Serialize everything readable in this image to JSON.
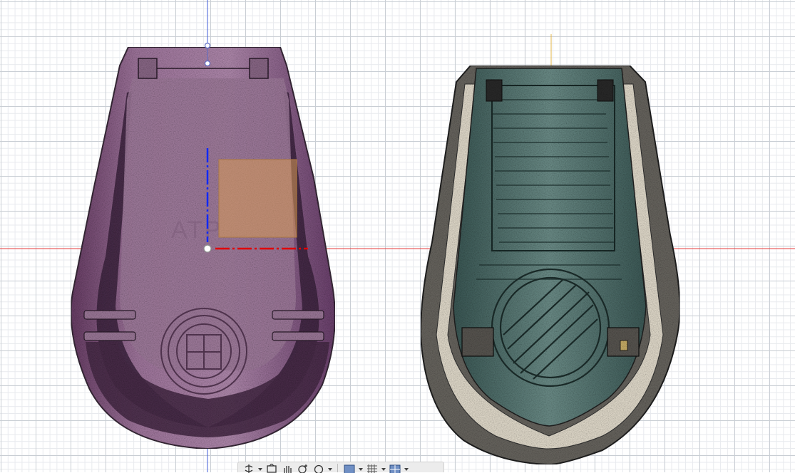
{
  "viewport": {
    "grid": true,
    "colors": {
      "grid_major": "#c9ced4",
      "grid_minor": "#e8eaee",
      "x_axis": "#e63b3b",
      "y_axis_left": "#3f5bd8",
      "y_axis_right": "#e3b64a"
    },
    "bodies": [
      {
        "name": "left-body",
        "view": "underside",
        "color": "#9a6a96"
      },
      {
        "name": "right-body",
        "view": "inside",
        "color": "#5d7f7b",
        "shell_color": "#6b6862"
      }
    ]
  },
  "sketch": {
    "watermark_text": "ATP",
    "colors": {
      "profile_fill": "#d89a55",
      "profile_edge": "#b07a3e",
      "axis_blue": "#1029ff",
      "axis_red": "#e00000"
    }
  },
  "nav_toolbar": {
    "buttons": [
      {
        "name": "orbit",
        "icon": "orbit-icon",
        "has_menu": true
      },
      {
        "name": "look-at",
        "icon": "look-at-icon",
        "has_menu": false
      },
      {
        "name": "pan",
        "icon": "pan-hand-icon",
        "has_menu": false
      },
      {
        "name": "zoom",
        "icon": "zoom-icon",
        "has_menu": false
      },
      {
        "name": "zoom-window",
        "icon": "zoom-window-icon",
        "has_menu": true
      },
      {
        "name": "display-settings",
        "icon": "display-settings-icon",
        "has_menu": true
      },
      {
        "name": "grid-snaps",
        "icon": "grid-snaps-icon",
        "has_menu": true
      },
      {
        "name": "viewports",
        "icon": "viewports-icon",
        "has_menu": true
      }
    ]
  }
}
